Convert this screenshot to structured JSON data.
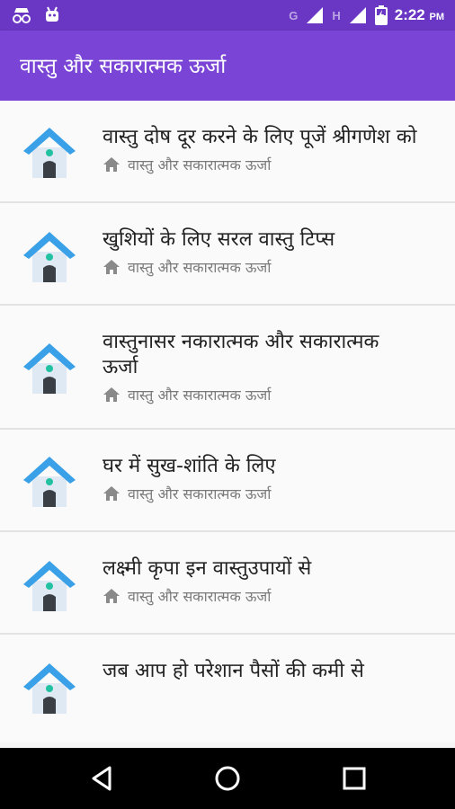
{
  "status_bar": {
    "time": "2:22",
    "ampm": "PM",
    "network_g": "G",
    "network_h": "H"
  },
  "app_bar": {
    "title": "वास्तु और सकारात्मक ऊर्जा"
  },
  "articles": [
    {
      "title": "वास्तु दोष दूर करने के लिए पूजें श्रीगणेश को",
      "category": "वास्तु और सकारात्मक ऊर्जा"
    },
    {
      "title": "खुशियों के लिए सरल वास्तु टिप्स",
      "category": "वास्तु और सकारात्मक ऊर्जा"
    },
    {
      "title": "वास्तुनासर नकारात्मक और सकारात्मक ऊर्जा",
      "category": "वास्तु और सकारात्मक ऊर्जा"
    },
    {
      "title": "घर में सुख-शांति के लिए",
      "category": "वास्तु और सकारात्मक ऊर्जा"
    },
    {
      "title": "लक्ष्मी कृपा इन वास्तुउपायों से",
      "category": "वास्तु और सकारात्मक ऊर्जा"
    },
    {
      "title": "जब आप हो परेशान पैसों की कमी से",
      "category": ""
    }
  ],
  "icons": {
    "item": "house-icon",
    "category": "small-house-icon",
    "nav": [
      "back-icon",
      "home-circle-icon",
      "recents-square-icon"
    ]
  },
  "colors": {
    "status_bar": "#6a37c4",
    "app_bar": "#7a45d6",
    "roof": "#3aa0e8",
    "house_body": "#dfe9f3",
    "window": "#22c1a1",
    "door": "#3a3f46"
  }
}
